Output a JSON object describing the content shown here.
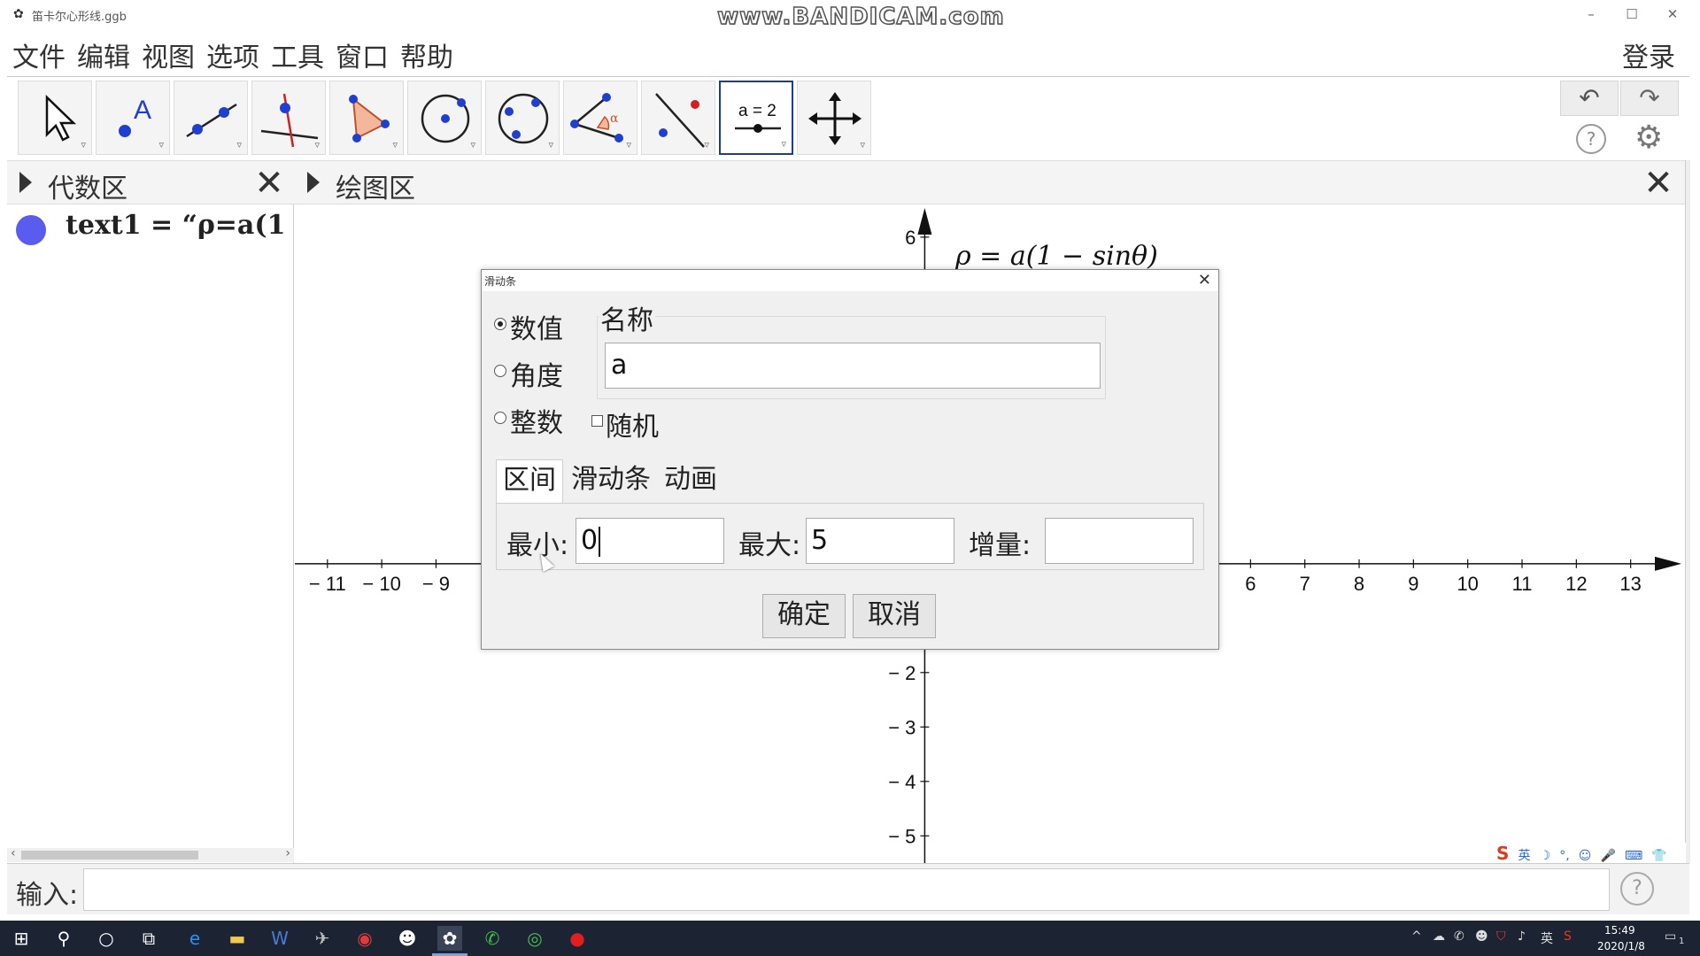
{
  "window": {
    "title": "笛卡尔心形线.ggb",
    "watermark": "www.BANDICAM.com",
    "minimize": "–",
    "maximize": "☐",
    "close": "✕"
  },
  "menu": {
    "items": [
      "文件",
      "编辑",
      "视图",
      "选项",
      "工具",
      "窗口",
      "帮助"
    ],
    "login": "登录"
  },
  "toolbar": {
    "tools": [
      {
        "name": "move-tool",
        "icon": "arrow-cursor-icon"
      },
      {
        "name": "point-tool",
        "icon": "point-icon"
      },
      {
        "name": "line-tool",
        "icon": "line-icon"
      },
      {
        "name": "perpendicular-tool",
        "icon": "perpendicular-line-icon"
      },
      {
        "name": "polygon-tool",
        "icon": "polygon-icon"
      },
      {
        "name": "circle-center-tool",
        "icon": "circle-center-icon"
      },
      {
        "name": "circle-three-points-tool",
        "icon": "circle-three-points-icon"
      },
      {
        "name": "angle-tool",
        "icon": "angle-icon"
      },
      {
        "name": "reflect-tool",
        "icon": "reflect-icon"
      },
      {
        "name": "slider-tool",
        "icon": "slider-icon",
        "label": "a = 2"
      },
      {
        "name": "move-graphics-tool",
        "icon": "move-cross-icon"
      }
    ],
    "undo": "↶",
    "redo": "↷",
    "help": "?",
    "settings": "⚙",
    "tool_dropdown": "▿"
  },
  "algebra_panel": {
    "title": "代数区",
    "close": "✕",
    "entries": [
      {
        "label": "text1  =  “ρ=a(1"
      }
    ],
    "scroll_left": "‹",
    "scroll_right": "›"
  },
  "graphics_panel": {
    "title": "绘图区",
    "close": "✕",
    "curve_label": "ρ = a(1 − sinθ)"
  },
  "chart_data": {
    "type": "axes",
    "x_ticks": [
      -11,
      -10,
      -9,
      6,
      7,
      8,
      9,
      10,
      11,
      12,
      13
    ],
    "y_ticks": [
      6,
      -2,
      -3,
      -4,
      -5
    ],
    "xlim": [
      -11.6,
      14.0
    ],
    "ylim": [
      -5.5,
      6.6
    ],
    "grid": false
  },
  "input_bar": {
    "label": "输入:",
    "value": "",
    "help": "?"
  },
  "ime_toolbar": {
    "logo": "S",
    "items": [
      "英",
      "☽",
      "°,",
      "☺",
      "🎤",
      "⌨",
      "👕",
      "👔",
      "▦"
    ]
  },
  "dialog": {
    "title": "滑动条",
    "close": "✕",
    "types": [
      {
        "label": "数值",
        "selected": true
      },
      {
        "label": "角度",
        "selected": false
      },
      {
        "label": "整数",
        "selected": false
      }
    ],
    "name_label": "名称",
    "name_value": "a",
    "random_label": "随机",
    "random_checked": false,
    "tabs": [
      "区间",
      "滑动条",
      "动画"
    ],
    "active_tab": "区间",
    "min_label": "最小:",
    "min_value": "0",
    "max_label": "最大:",
    "max_value": "5",
    "step_label": "增量:",
    "step_value": "",
    "ok": "确定",
    "cancel": "取消"
  },
  "taskbar": {
    "time": "15:49",
    "date": "2020/1/8",
    "ime_lang": "英",
    "notification_count": "1"
  }
}
